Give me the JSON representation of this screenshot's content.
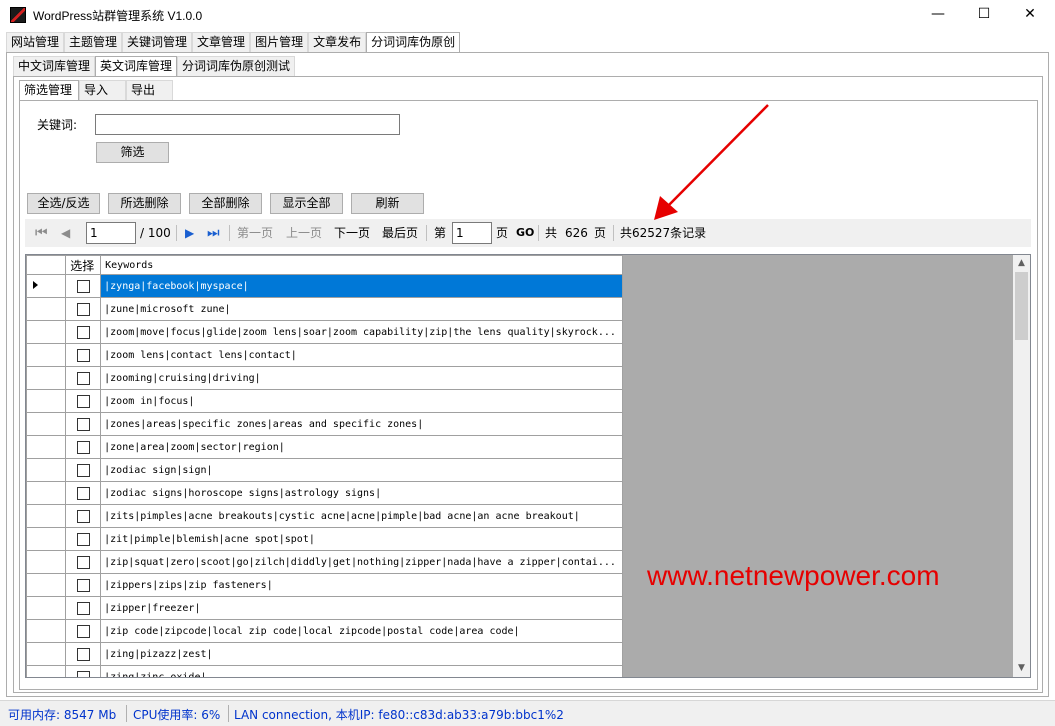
{
  "window": {
    "title": "WordPress站群管理系统 V1.0.0",
    "minimize": "—",
    "maximize": "☐",
    "close": "✕"
  },
  "main_tabs": [
    "网站管理",
    "主题管理",
    "关键词管理",
    "文章管理",
    "图片管理",
    "文章发布",
    "分词词库伪原创"
  ],
  "sub_tabs": [
    "中文词库管理",
    "英文词库管理",
    "分词词库伪原创测试"
  ],
  "inner_tabs": [
    "筛选管理",
    "导入",
    "导出"
  ],
  "filter": {
    "keyword_label": "关键词:",
    "keyword_value": "",
    "filter_button": "筛选"
  },
  "actions": {
    "select_all": "全选/反选",
    "delete_selected": "所选删除",
    "delete_all": "全部删除",
    "show_all": "显示全部",
    "refresh": "刷新"
  },
  "pager": {
    "current_page": "1",
    "total_pages_text": "/ 100",
    "first_page": "第一页",
    "prev_page": "上一页",
    "next_page": "下一页",
    "last_page": "最后页",
    "goto_prefix": "第",
    "goto_value": "1",
    "goto_suffix": "页",
    "go_button": "GO",
    "total_label": "共",
    "total_pages": "626",
    "total_pages_suffix": "页",
    "total_records": "共62527条记录"
  },
  "grid": {
    "columns": [
      "选择",
      "Keywords"
    ],
    "rows": [
      "|zynga|facebook|myspace|",
      "|zune|microsoft zune|",
      "|zoom|move|focus|glide|zoom lens|soar|zoom capability|zip|the lens quality|skyrock...",
      "|zoom lens|contact lens|contact|",
      "|zooming|cruising|driving|",
      "|zoom in|focus|",
      "|zones|areas|specific zones|areas and specific zones|",
      "|zone|area|zoom|sector|region|",
      "|zodiac sign|sign|",
      "|zodiac signs|horoscope signs|astrology signs|",
      "|zits|pimples|acne breakouts|cystic acne|acne|pimple|bad acne|an acne breakout|",
      "|zit|pimple|blemish|acne spot|spot|",
      "|zip|squat|zero|scoot|go|zilch|diddly|get|nothing|zipper|nada|have a zipper|contai...",
      "|zippers|zips|zip fasteners|",
      "|zipper|freezer|",
      "|zip code|zipcode|local zip code|local zipcode|postal code|area code|",
      "|zing|pizazz|zest|",
      "|zing|zinc oxide|"
    ]
  },
  "watermark": "www.netnewpower.com",
  "status": {
    "memory": "可用内存: 8547 Mb",
    "cpu": "CPU使用率: 6%",
    "network": "LAN connection, 本机IP: fe80::c83d:ab33:a79b:bbc1%2"
  },
  "colors": {
    "selected_row": "#0078d7",
    "watermark": "#e60000",
    "status_text": "#0033cc",
    "arrow": "#e60000"
  }
}
